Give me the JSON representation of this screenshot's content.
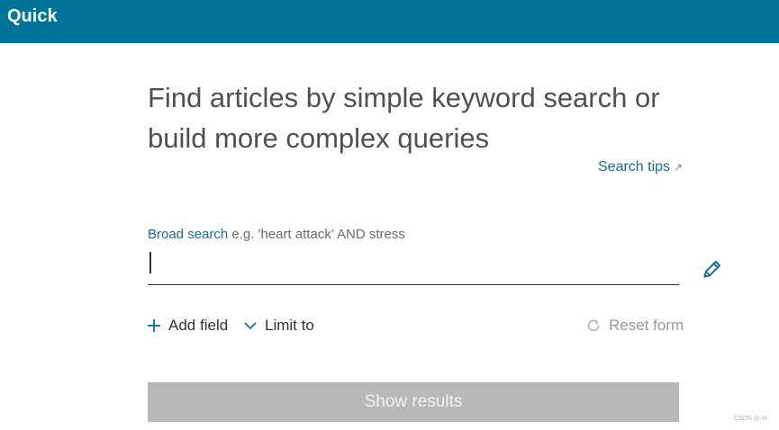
{
  "topbar": {
    "title": "Quick",
    "color": "#007398"
  },
  "page": {
    "heading_line1": "Find articles by simple keyword search or",
    "heading_line2": "build more complex queries",
    "search_tips": "Search tips"
  },
  "search": {
    "label": "Broad search",
    "hint": "e.g. 'heart attack' AND stress",
    "value": ""
  },
  "actions": {
    "add_field": "Add field",
    "limit_to": "Limit to",
    "reset_form": "Reset form",
    "show_results": "Show results"
  },
  "icons": [
    "plus-icon",
    "chevron-down-icon",
    "refresh-icon",
    "pencil-icon",
    "external-arrow-icon"
  ],
  "colors": {
    "accent": "#007398",
    "link": "#1a6b9a",
    "button_disabled": "#b8b8b8"
  },
  "watermark": "CSDN @-H"
}
